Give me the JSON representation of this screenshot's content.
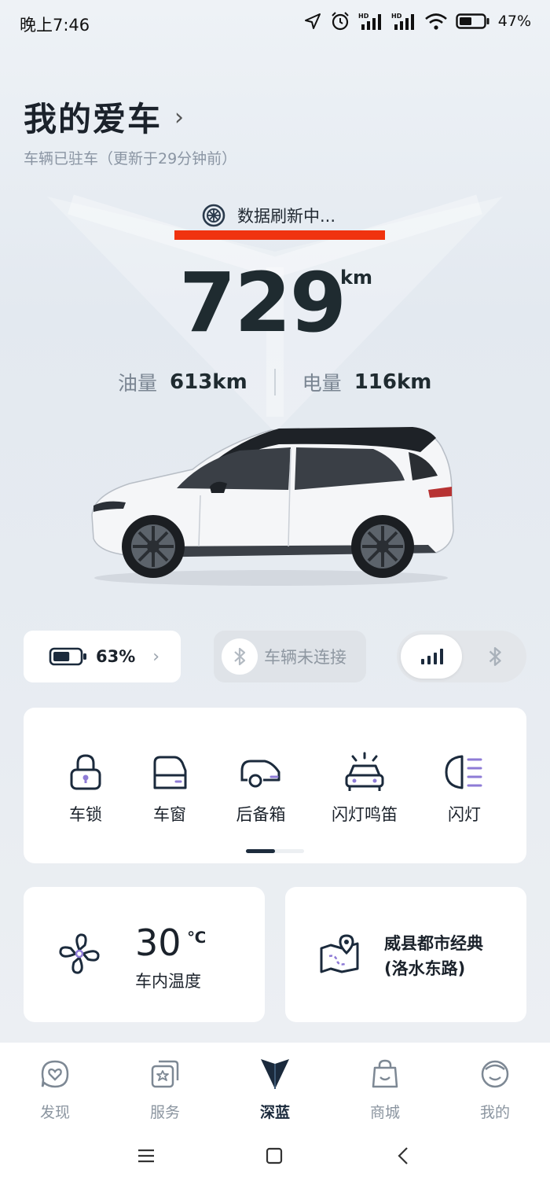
{
  "status_bar": {
    "time": "晚上7:46",
    "battery_percent": "47%",
    "icons": [
      "location-arrow-icon",
      "alarm-icon",
      "signal-hd-icon",
      "signal-hd-icon",
      "wifi-icon",
      "battery-icon"
    ]
  },
  "header": {
    "title": "我的爱车",
    "chevron": "›",
    "subtitle": "车辆已驻车（更新于29分钟前）"
  },
  "vehicle": {
    "refresh_text": "数据刷新中...",
    "range_value": "729",
    "range_unit": "km",
    "fuel_label": "油量",
    "fuel_value": "613km",
    "electric_label": "电量",
    "electric_value": "116km"
  },
  "controls": {
    "battery_level": "63%",
    "battery_level_fraction": 0.63,
    "battery_chevron": "›",
    "bluetooth_status": "车辆未连接",
    "connection_mode": "signal"
  },
  "quick_actions": [
    {
      "label": "车锁",
      "icon": "lock-icon"
    },
    {
      "label": "车窗",
      "icon": "car-window-icon"
    },
    {
      "label": "后备箱",
      "icon": "trunk-icon"
    },
    {
      "label": "闪灯鸣笛",
      "icon": "flash-horn-icon"
    },
    {
      "label": "闪灯",
      "icon": "headlight-icon"
    }
  ],
  "quick_actions_page": {
    "current": 1,
    "total": 2
  },
  "climate": {
    "temperature": "30",
    "unit": "℃",
    "label": "车内温度",
    "icon": "fan-icon"
  },
  "location": {
    "line1": "威县都市经典",
    "line2": "(洛水东路)",
    "icon": "map-pin-icon"
  },
  "bottom_nav": [
    {
      "label": "发现",
      "icon": "discover-icon",
      "active": false
    },
    {
      "label": "服务",
      "icon": "service-icon",
      "active": false
    },
    {
      "label": "深蓝",
      "icon": "deepal-logo-icon",
      "active": true
    },
    {
      "label": "商城",
      "icon": "shop-bag-icon",
      "active": false
    },
    {
      "label": "我的",
      "icon": "profile-icon",
      "active": false
    }
  ],
  "system_nav": [
    "menu-icon",
    "home-icon",
    "back-icon"
  ],
  "colors": {
    "accent": "#1d2c3d",
    "highlight_underline": "#f0330f",
    "background": "#e9edf2"
  }
}
